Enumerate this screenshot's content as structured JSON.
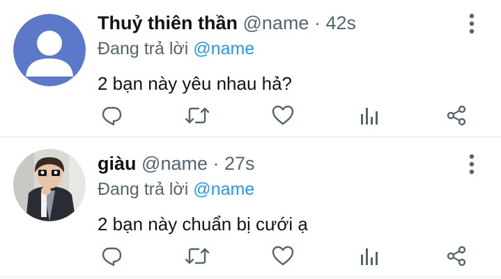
{
  "tweets": [
    {
      "display_name": "Thuỷ thiên thần",
      "handle": "@name",
      "separator": "·",
      "time": "42s",
      "reply_prefix": "Đang trả lời",
      "reply_to": "@name",
      "text": "2 bạn này yêu nhau hả?",
      "avatar": "default-avatar"
    },
    {
      "display_name": "giàu",
      "handle": "@name",
      "separator": "·",
      "time": "27s",
      "reply_prefix": "Đang trả lời",
      "reply_to": "@name",
      "text": "2 bạn này chuẩn bị cưới ạ",
      "avatar": "photo-avatar"
    }
  ],
  "icons": [
    "reply-icon",
    "retweet-icon",
    "like-icon",
    "views-icon",
    "share-icon",
    "more-icon"
  ],
  "colors": {
    "text": "#0f1419",
    "muted": "#536471",
    "link": "#1d9bf0",
    "divider": "#eff3f4",
    "default_avatar_bg": "#5b78c9"
  }
}
